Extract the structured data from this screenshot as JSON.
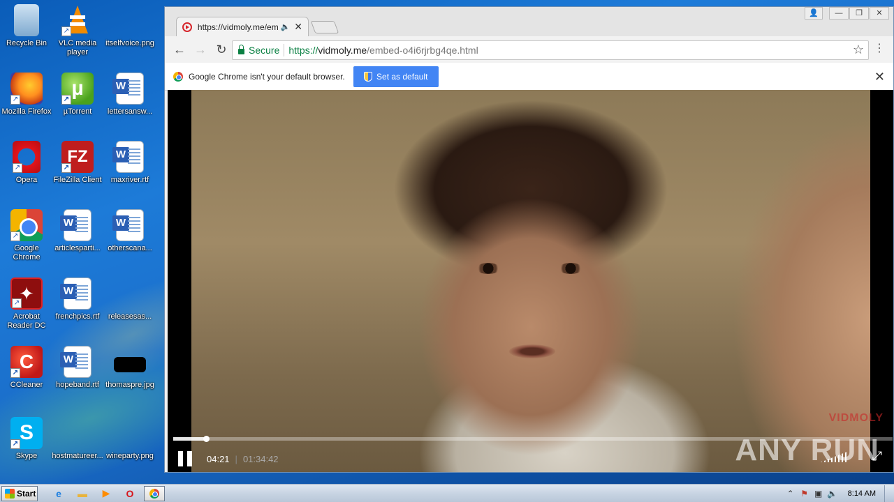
{
  "desktop": {
    "icons": [
      {
        "label": "Recycle Bin",
        "icon": "recycle-bin-icon"
      },
      {
        "label": "VLC media player",
        "icon": "vlc-icon"
      },
      {
        "label": "itselfvoice.png",
        "icon": "image-file-icon"
      },
      {
        "label": "Mozilla Firefox",
        "icon": "firefox-icon"
      },
      {
        "label": "µTorrent",
        "icon": "utorrent-icon"
      },
      {
        "label": "lettersansw...",
        "icon": "word-doc-icon"
      },
      {
        "label": "Opera",
        "icon": "opera-icon"
      },
      {
        "label": "FileZilla Client",
        "icon": "filezilla-icon"
      },
      {
        "label": "maxriver.rtf",
        "icon": "word-doc-icon"
      },
      {
        "label": "Google Chrome",
        "icon": "chrome-icon"
      },
      {
        "label": "articlesparti...",
        "icon": "word-doc-icon"
      },
      {
        "label": "otherscana...",
        "icon": "word-doc-icon"
      },
      {
        "label": "Acrobat Reader DC",
        "icon": "acrobat-icon"
      },
      {
        "label": "frenchpics.rtf",
        "icon": "word-doc-icon"
      },
      {
        "label": "releasesas...",
        "icon": "image-file-icon"
      },
      {
        "label": "CCleaner",
        "icon": "ccleaner-icon"
      },
      {
        "label": "hopeband.rtf",
        "icon": "word-doc-icon"
      },
      {
        "label": "thomaspre.jpg",
        "icon": "image-file-icon"
      },
      {
        "label": "Skype",
        "icon": "skype-icon"
      },
      {
        "label": "hostmatureer...",
        "icon": "image-file-icon"
      },
      {
        "label": "wineparty.png",
        "icon": "image-file-icon"
      }
    ]
  },
  "browser": {
    "tab": {
      "title": "https://vidmoly.me/emb",
      "audio_icon": "speaker-icon"
    },
    "window_controls": {
      "profile": "profile-icon",
      "minimize": "minimize-icon",
      "maximize": "maximize-icon",
      "close": "close-icon"
    },
    "omnibox": {
      "secure_label": "Secure",
      "url_scheme": "https://",
      "url_host": "vidmoly.me",
      "url_path": "/embed-o4i6rjrbg4qe.html"
    },
    "infobar": {
      "message": "Google Chrome isn't your default browser.",
      "button_label": "Set as default"
    }
  },
  "player": {
    "current_time": "04:21",
    "separator": "|",
    "total_time": "01:34:42",
    "progress_fraction": 0.046,
    "watermark": "VIDMOLY",
    "overlay_text": "ANY RUN"
  },
  "taskbar": {
    "start_label": "Start",
    "clock": "8:14 AM",
    "apps": [
      "ie-icon",
      "explorer-icon",
      "media-player-icon",
      "opera-icon",
      "chrome-icon"
    ]
  },
  "colors": {
    "secure_green": "#0b8043",
    "button_blue": "#4285f4",
    "desktop_blue": "#1d7bd8"
  }
}
